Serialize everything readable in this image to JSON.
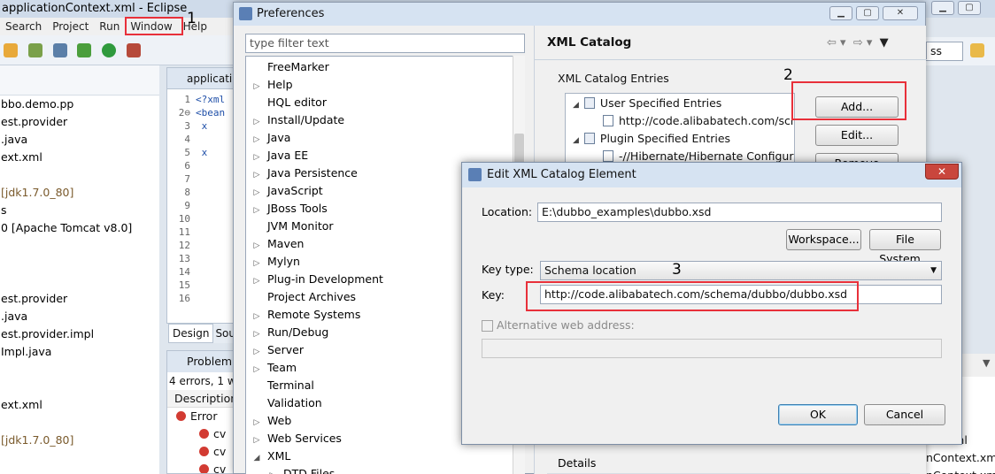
{
  "eclipse": {
    "title": "applicationContext.xml - Eclipse",
    "menu": [
      "Search",
      "Project",
      "Run",
      "Window",
      "Help"
    ],
    "left_tree": [
      {
        "text": "bbo.demo.pp",
        "style": "normal"
      },
      {
        "text": "est.provider",
        "style": "normal"
      },
      {
        "text": ".java",
        "style": "normal"
      },
      {
        "text": "ext.xml",
        "style": "normal"
      },
      {
        "text": "",
        "style": "normal"
      },
      {
        "text": "[jdk1.7.0_80]",
        "style": "brown"
      },
      {
        "text": "s",
        "style": "normal"
      },
      {
        "text": "0 [Apache Tomcat v8.0]",
        "style": "normal"
      },
      {
        "text": "",
        "style": "normal"
      },
      {
        "text": "",
        "style": "normal"
      },
      {
        "text": "",
        "style": "normal"
      },
      {
        "text": "est.provider",
        "style": "normal"
      },
      {
        "text": ".java",
        "style": "normal"
      },
      {
        "text": "est.provider.impl",
        "style": "normal"
      },
      {
        "text": "Impl.java",
        "style": "normal"
      },
      {
        "text": "",
        "style": "normal"
      },
      {
        "text": "",
        "style": "normal"
      },
      {
        "text": "ext.xml",
        "style": "normal"
      },
      {
        "text": "",
        "style": "normal"
      },
      {
        "text": "[jdk1.7.0_80]",
        "style": "brown"
      }
    ],
    "editor_tab": "applicati",
    "editor_lines": [
      {
        "no": "1",
        "code": "<?xml"
      },
      {
        "no": "2⊖",
        "code": "<bean"
      },
      {
        "no": "3",
        "code": "  x"
      },
      {
        "no": "4",
        "code": ""
      },
      {
        "no": "5",
        "code": "  x"
      },
      {
        "no": "6",
        "code": ""
      },
      {
        "no": "7",
        "code": ""
      },
      {
        "no": "8",
        "code": ""
      },
      {
        "no": "9",
        "code": ""
      },
      {
        "no": "10",
        "code": ""
      },
      {
        "no": "11",
        "code": ""
      },
      {
        "no": "12",
        "code": ""
      },
      {
        "no": "13",
        "code": ""
      },
      {
        "no": "14",
        "code": ""
      },
      {
        "no": "15",
        "code": ""
      },
      {
        "no": "16",
        "code": ""
      }
    ],
    "design_tabs": [
      "Design",
      "Sou"
    ],
    "problems_title": "Problem",
    "problems_summary": "4 errors, 1 w",
    "problems_header": "Description",
    "problems_rows": [
      "Error",
      "cv",
      "cv",
      "cv"
    ],
    "bottom_right": [
      "ext.xml",
      "nContext.xml",
      "nContext.xml"
    ],
    "quick_access": "ss"
  },
  "prefs": {
    "title": "Preferences",
    "filter_placeholder": "type filter text",
    "tree": [
      {
        "label": "FreeMarker",
        "arrow": ""
      },
      {
        "label": "Help",
        "arrow": "▷"
      },
      {
        "label": "HQL editor",
        "arrow": ""
      },
      {
        "label": "Install/Update",
        "arrow": "▷"
      },
      {
        "label": "Java",
        "arrow": "▷"
      },
      {
        "label": "Java EE",
        "arrow": "▷"
      },
      {
        "label": "Java Persistence",
        "arrow": "▷"
      },
      {
        "label": "JavaScript",
        "arrow": "▷"
      },
      {
        "label": "JBoss Tools",
        "arrow": "▷"
      },
      {
        "label": "JVM Monitor",
        "arrow": ""
      },
      {
        "label": "Maven",
        "arrow": "▷"
      },
      {
        "label": "Mylyn",
        "arrow": "▷"
      },
      {
        "label": "Plug-in Development",
        "arrow": "▷"
      },
      {
        "label": "Project Archives",
        "arrow": ""
      },
      {
        "label": "Remote Systems",
        "arrow": "▷"
      },
      {
        "label": "Run/Debug",
        "arrow": "▷"
      },
      {
        "label": "Server",
        "arrow": "▷"
      },
      {
        "label": "Team",
        "arrow": "▷"
      },
      {
        "label": "Terminal",
        "arrow": ""
      },
      {
        "label": "Validation",
        "arrow": ""
      },
      {
        "label": "Web",
        "arrow": "▷"
      },
      {
        "label": "Web Services",
        "arrow": "▷"
      },
      {
        "label": "XML",
        "arrow": "◢"
      },
      {
        "label": "DTD Files",
        "arrow": "▷",
        "indent": true
      }
    ],
    "page_title": "XML Catalog",
    "entries_label": "XML Catalog Entries",
    "entries": [
      {
        "label": "User Specified Entries",
        "level": 0
      },
      {
        "label": "http://code.alibabatech.com/schema",
        "level": 1
      },
      {
        "label": "Plugin Specified Entries",
        "level": 0
      },
      {
        "label": "-//Hibernate/Hibernate Configura",
        "level": 1
      }
    ],
    "add_button": "Add...",
    "edit_button": "Edit...",
    "remove_button": "Remove",
    "details_label": "Details"
  },
  "edit_dialog": {
    "title": "Edit XML Catalog Element",
    "location_label": "Location:",
    "location_value": "E:\\dubbo_examples\\dubbo.xsd",
    "workspace_button": "Workspace...",
    "filesystem_button": "File System...",
    "keytype_label": "Key type:",
    "keytype_value": "Schema location",
    "key_label": "Key:",
    "key_value": "http://code.alibabatech.com/schema/dubbo/dubbo.xsd",
    "alt_label": "Alternative web address:",
    "ok_button": "OK",
    "cancel_button": "Cancel"
  },
  "annotations": [
    "1",
    "2",
    "3"
  ],
  "colors": {
    "highlight": "#e8303a",
    "title_bar": "#d6e3f2",
    "close_button": "#c9463d"
  }
}
